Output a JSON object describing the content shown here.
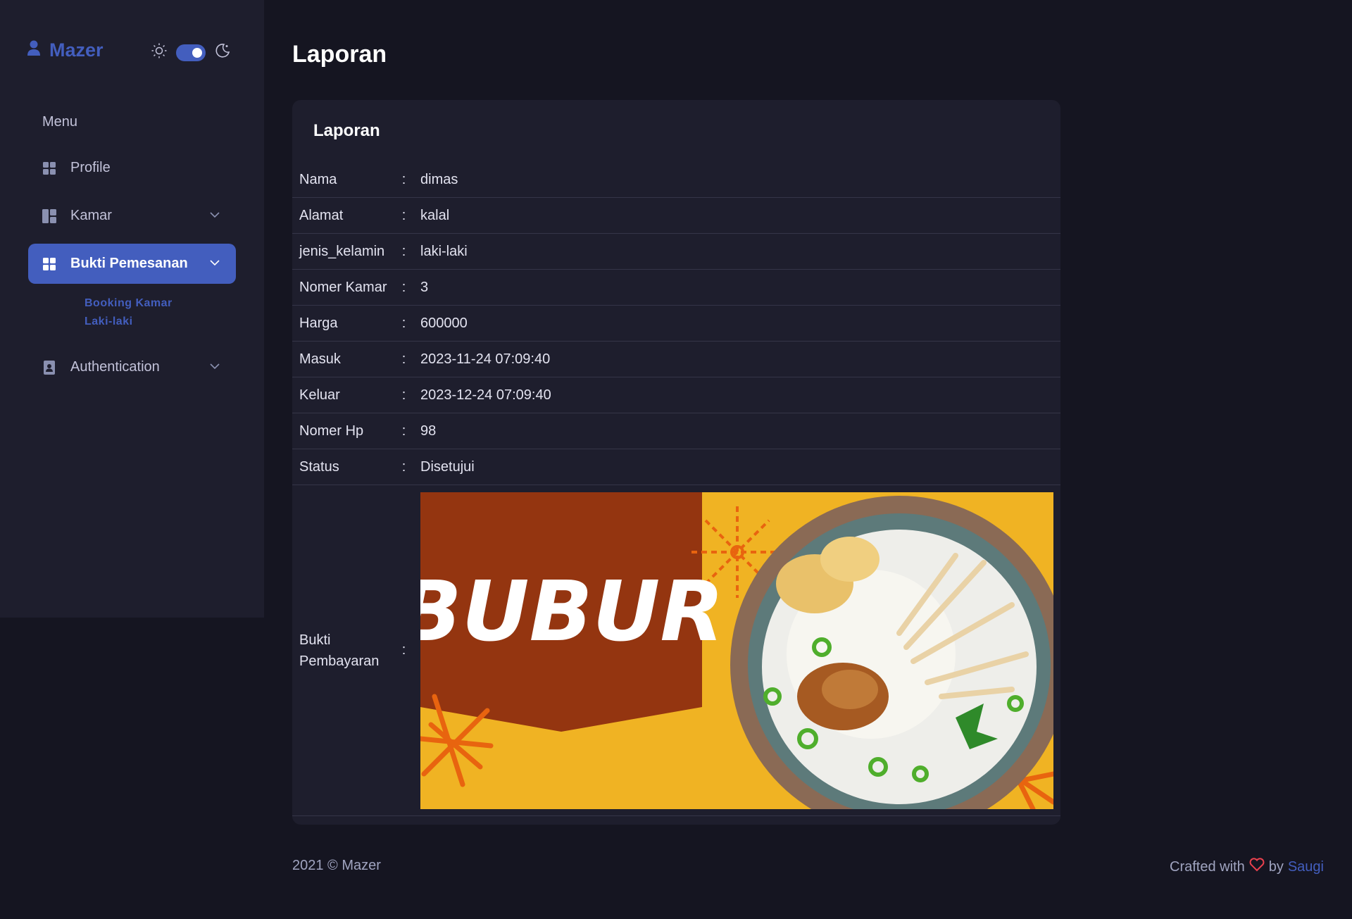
{
  "brand": {
    "name": "Mazer",
    "icon": "person-icon"
  },
  "theme": {
    "light_icon": "sun-icon",
    "dark_icon": "moon-icon",
    "mode": "dark"
  },
  "sidebar": {
    "menu_title": "Menu",
    "items": [
      {
        "label": "Profile",
        "icon": "grid-icon",
        "has_chevron": false,
        "active": false
      },
      {
        "label": "Kamar",
        "icon": "layout-icon",
        "has_chevron": true,
        "active": false
      },
      {
        "label": "Bukti Pemesanan",
        "icon": "grid-icon",
        "has_chevron": true,
        "active": true
      },
      {
        "label": "Authentication",
        "icon": "contact-book-icon",
        "has_chevron": true,
        "active": false
      }
    ],
    "submenu": [
      {
        "label": "Booking Kamar Laki-laki"
      }
    ]
  },
  "page": {
    "title": "Laporan"
  },
  "card": {
    "title": "Laporan",
    "separator": ":",
    "rows": [
      {
        "label": "Nama",
        "value": "dimas"
      },
      {
        "label": "Alamat",
        "value": "kalal"
      },
      {
        "label": "jenis_kelamin",
        "value": "laki-laki"
      },
      {
        "label": "Nomer Kamar",
        "value": "3"
      },
      {
        "label": "Harga",
        "value": "600000"
      },
      {
        "label": "Masuk",
        "value": "2023-11-24 07:09:40"
      },
      {
        "label": "Keluar",
        "value": "2023-12-24 07:09:40"
      },
      {
        "label": "Nomer Hp",
        "value": "98"
      },
      {
        "label": "Status",
        "value": "Disetujui"
      }
    ],
    "proof": {
      "label": "Bukti Pembayaran",
      "image_text": "BUBUR"
    }
  },
  "footer": {
    "left": "2021 © Mazer",
    "right_prefix": "Crafted with",
    "right_by": "by",
    "right_link": "Saugi",
    "heart_color": "#e9414e"
  },
  "colors": {
    "accent": "#435ebe",
    "sidebar_bg": "#1e1e2d",
    "page_bg": "#151521"
  }
}
